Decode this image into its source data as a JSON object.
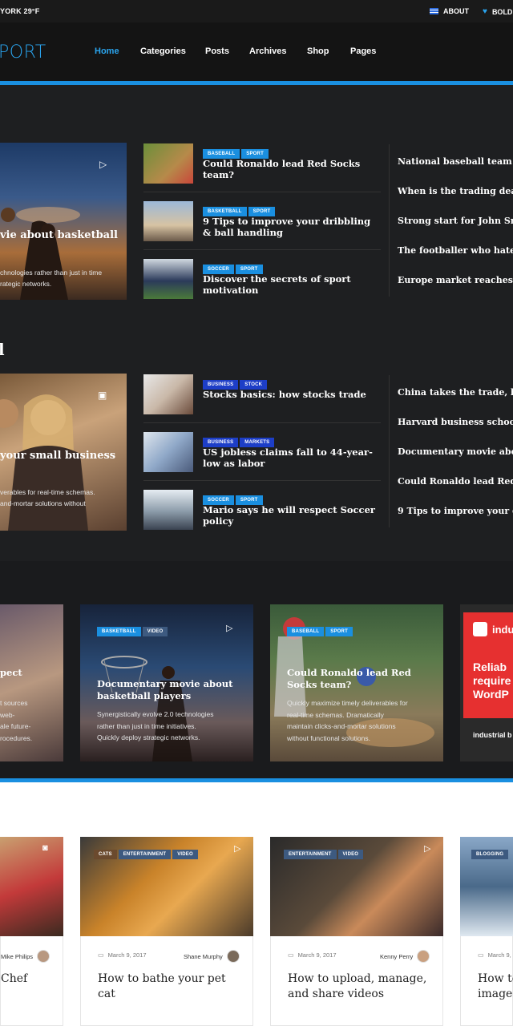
{
  "topbar": {
    "weather": "YORK 29°F",
    "about": "ABOUT",
    "bold": "BOLD"
  },
  "header": {
    "logo": "PORT",
    "nav": [
      "Home",
      "Categories",
      "Posts",
      "Archives",
      "Shop",
      "Pages"
    ]
  },
  "section1": {
    "hero": {
      "title": "vie about basketball",
      "excerpt": [
        "chnologies rather than just in time",
        "rategic networks."
      ]
    },
    "middle": [
      {
        "tags": [
          "BASEBALL",
          "SPORT"
        ],
        "title": "Could Ronaldo lead Red Socks team?"
      },
      {
        "tags": [
          "BASKETBALL",
          "SPORT"
        ],
        "title": "9 Tips to improve your dribbling & ball handling"
      },
      {
        "tags": [
          "SOCCER",
          "SPORT"
        ],
        "title": "Discover the secrets of sport motivation"
      }
    ],
    "right": [
      "National baseball team trav",
      "When is the trading deadlin",
      "Strong start for John Smith",
      "The footballer who hated so",
      "Europe market reaches une"
    ]
  },
  "section2": {
    "heading_fragment": "l",
    "hero": {
      "title": "your small business",
      "excerpt": [
        "verables for real-time schemas.",
        "and-mortar solutions without"
      ]
    },
    "middle": [
      {
        "tags": [
          "BUSINESS",
          "STOCK"
        ],
        "title": "Stocks basics: how stocks trade"
      },
      {
        "tags": [
          "BUSINESS",
          "MARKETS"
        ],
        "title": "US jobless claims fall to 44-year-low as labor"
      },
      {
        "tags": [
          "SOCCER",
          "SPORT"
        ],
        "title": "Mario says he will respect Soccer policy"
      }
    ],
    "right": [
      "China takes the trade, but G",
      "Harvard business school an",
      "Documentary movie about b",
      "Could Ronaldo lead Red Soc",
      "9 Tips to improve your drib"
    ]
  },
  "slider": [
    {
      "title": "pect",
      "excerpt": [
        "t sources",
        "web-",
        "ale future-",
        "rocedures."
      ]
    },
    {
      "tags": [
        "BASKETBALL",
        "VIDEO"
      ],
      "title": "Documentary movie about basketball players",
      "excerpt": [
        "Synergistically evolve 2.0 technologies",
        "rather than just in time initiatives.",
        "Quickly deploy strategic networks."
      ]
    },
    {
      "tags": [
        "BASEBALL",
        "SPORT"
      ],
      "title": "Could Ronaldo lead Red Socks team?",
      "excerpt": [
        "Quickly maximize timely deliverables for",
        "real-time schemas. Dramatically",
        "maintain clicks-and-mortar solutions",
        "without functional solutions."
      ]
    },
    {
      "ad_brand": "indu",
      "ad_text": [
        "Reliab",
        "require",
        "WordP"
      ],
      "ad_footer": "industrial b"
    }
  ],
  "bottom": [
    {
      "author": "Mike Philips",
      "title": "Chef"
    },
    {
      "tags": [
        "CATS",
        "ENTERTAINMENT",
        "VIDEO"
      ],
      "date": "March 9, 2017",
      "author": "Shane Murphy",
      "title": "How to bathe your pet cat"
    },
    {
      "tags": [
        "ENTERTAINMENT",
        "VIDEO"
      ],
      "date": "March 9, 2017",
      "author": "Kenny Perry",
      "title": "How to upload, manage, and share videos"
    },
    {
      "tags": [
        "BLOGGING"
      ],
      "date": "March 9, 2",
      "title": "How to images"
    }
  ]
}
